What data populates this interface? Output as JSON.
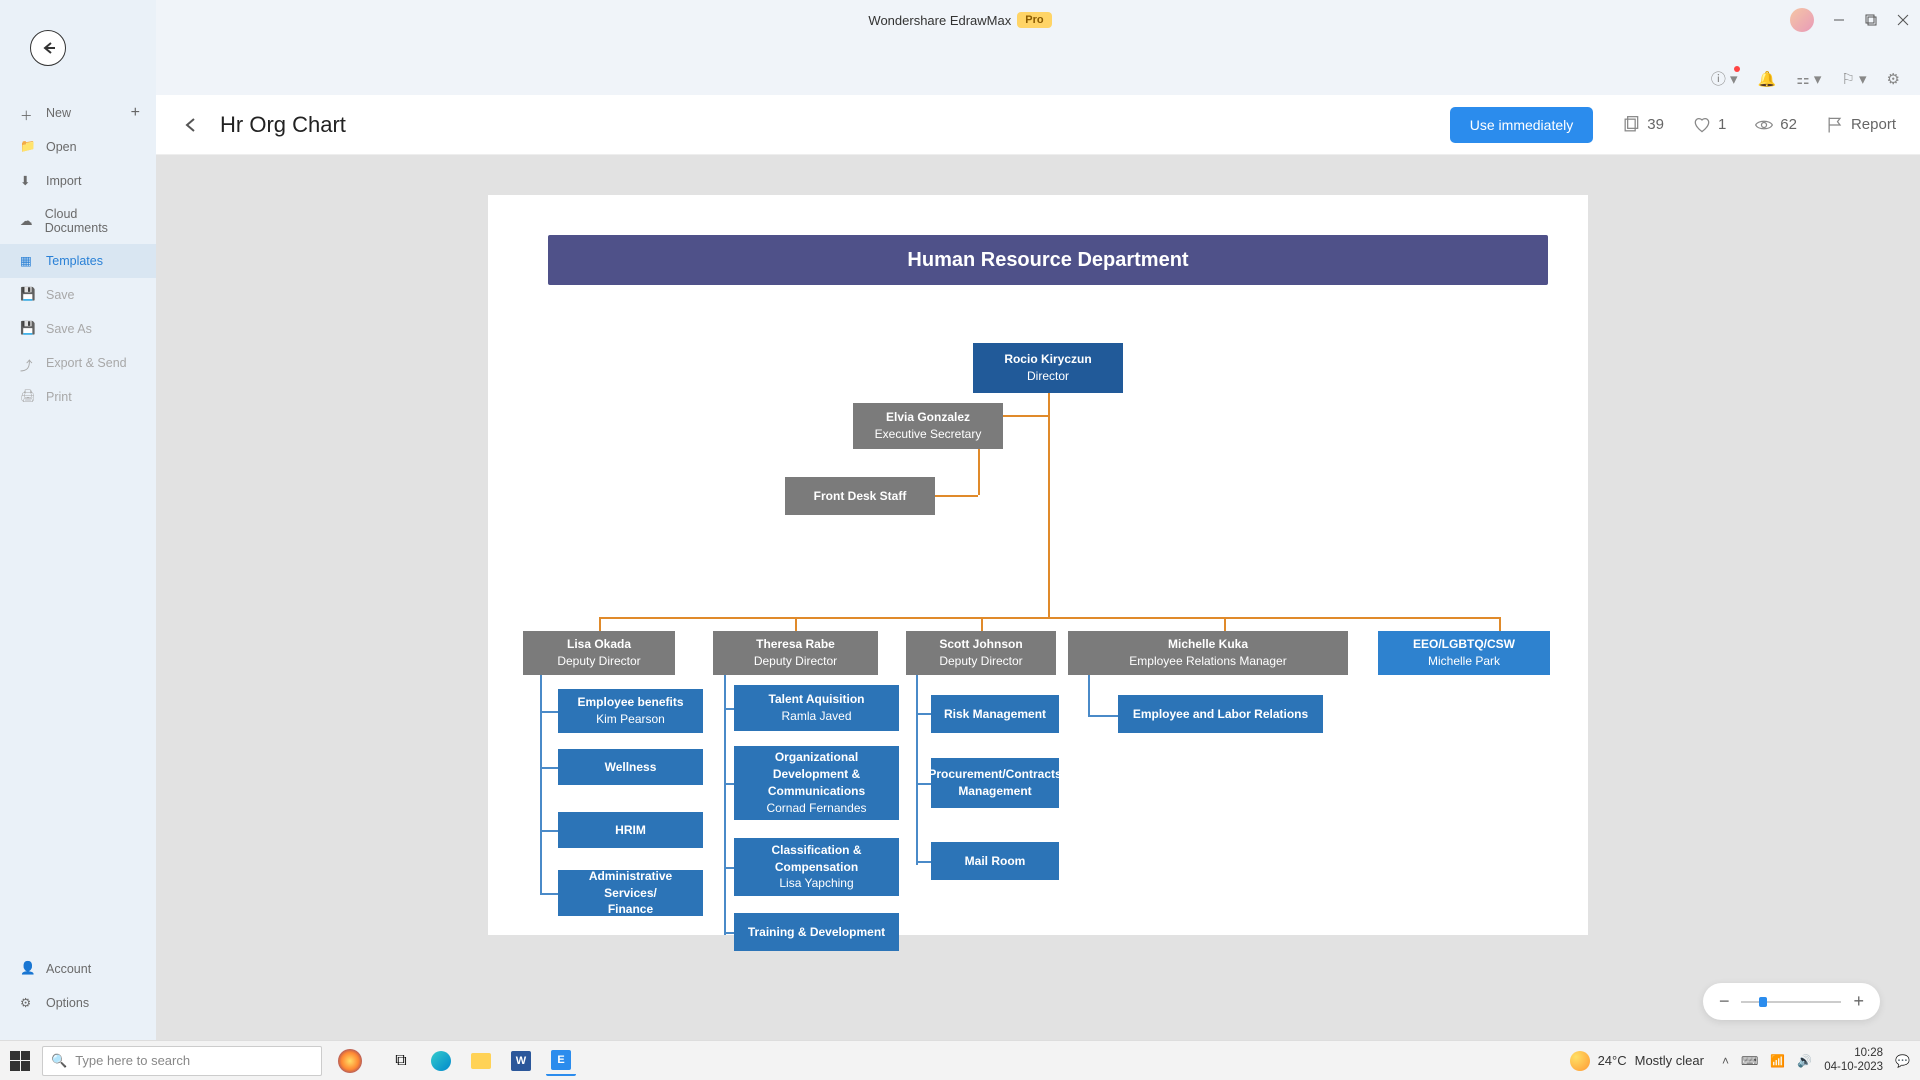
{
  "app": {
    "title": "Wondershare EdrawMax",
    "badge": "Pro"
  },
  "sidebar": {
    "items": [
      {
        "label": "New"
      },
      {
        "label": "Open"
      },
      {
        "label": "Import"
      },
      {
        "label": "Cloud Documents"
      },
      {
        "label": "Templates"
      },
      {
        "label": "Save"
      },
      {
        "label": "Save As"
      },
      {
        "label": "Export & Send"
      },
      {
        "label": "Print"
      }
    ],
    "bottom": [
      {
        "label": "Account"
      },
      {
        "label": "Options"
      }
    ]
  },
  "header": {
    "title": "Hr Org Chart",
    "use_btn": "Use immediately",
    "copies": "39",
    "likes": "1",
    "views": "62",
    "report": "Report"
  },
  "org": {
    "title": "Human Resource Department",
    "director": {
      "name": "Rocio Kiryczun",
      "role": "Director"
    },
    "exec": {
      "name": "Elvia Gonzalez",
      "role": "Executive Secretary"
    },
    "front": {
      "name": "Front Desk Staff"
    },
    "deps": [
      {
        "name": "Lisa Okada",
        "role": "Deputy Director"
      },
      {
        "name": "Theresa Rabe",
        "role": "Deputy Director"
      },
      {
        "name": "Scott Johnson",
        "role": "Deputy Director"
      },
      {
        "name": "Michelle Kuka",
        "role": "Employee Relations Manager"
      },
      {
        "name": "EEO/LGBTQ/CSW",
        "role": "Michelle Park"
      }
    ],
    "col1": [
      {
        "l1": "Employee benefits",
        "l2": "Kim Pearson"
      },
      {
        "l1": "Wellness"
      },
      {
        "l1": "HRIM"
      },
      {
        "l1": "Administrative Services/",
        "l2": "Finance"
      }
    ],
    "col2": [
      {
        "l1": "Talent Aquisition",
        "l2": "Ramla Javed"
      },
      {
        "l1": "Organizational Development & Communications",
        "l2": "Cornad Fernandes"
      },
      {
        "l1": "Classification & Compensation",
        "l2": "Lisa Yapching"
      },
      {
        "l1": "Training & Development"
      }
    ],
    "col3": [
      {
        "l1": "Risk Management"
      },
      {
        "l1": "Procurement/Contracts Management"
      },
      {
        "l1": "Mail Room"
      }
    ],
    "col4": [
      {
        "l1": "Employee and Labor Relations"
      }
    ]
  },
  "taskbar": {
    "search_placeholder": "Type here to search",
    "weather_temp": "24°C",
    "weather_desc": "Mostly clear",
    "time": "10:28",
    "date": "04-10-2023"
  }
}
